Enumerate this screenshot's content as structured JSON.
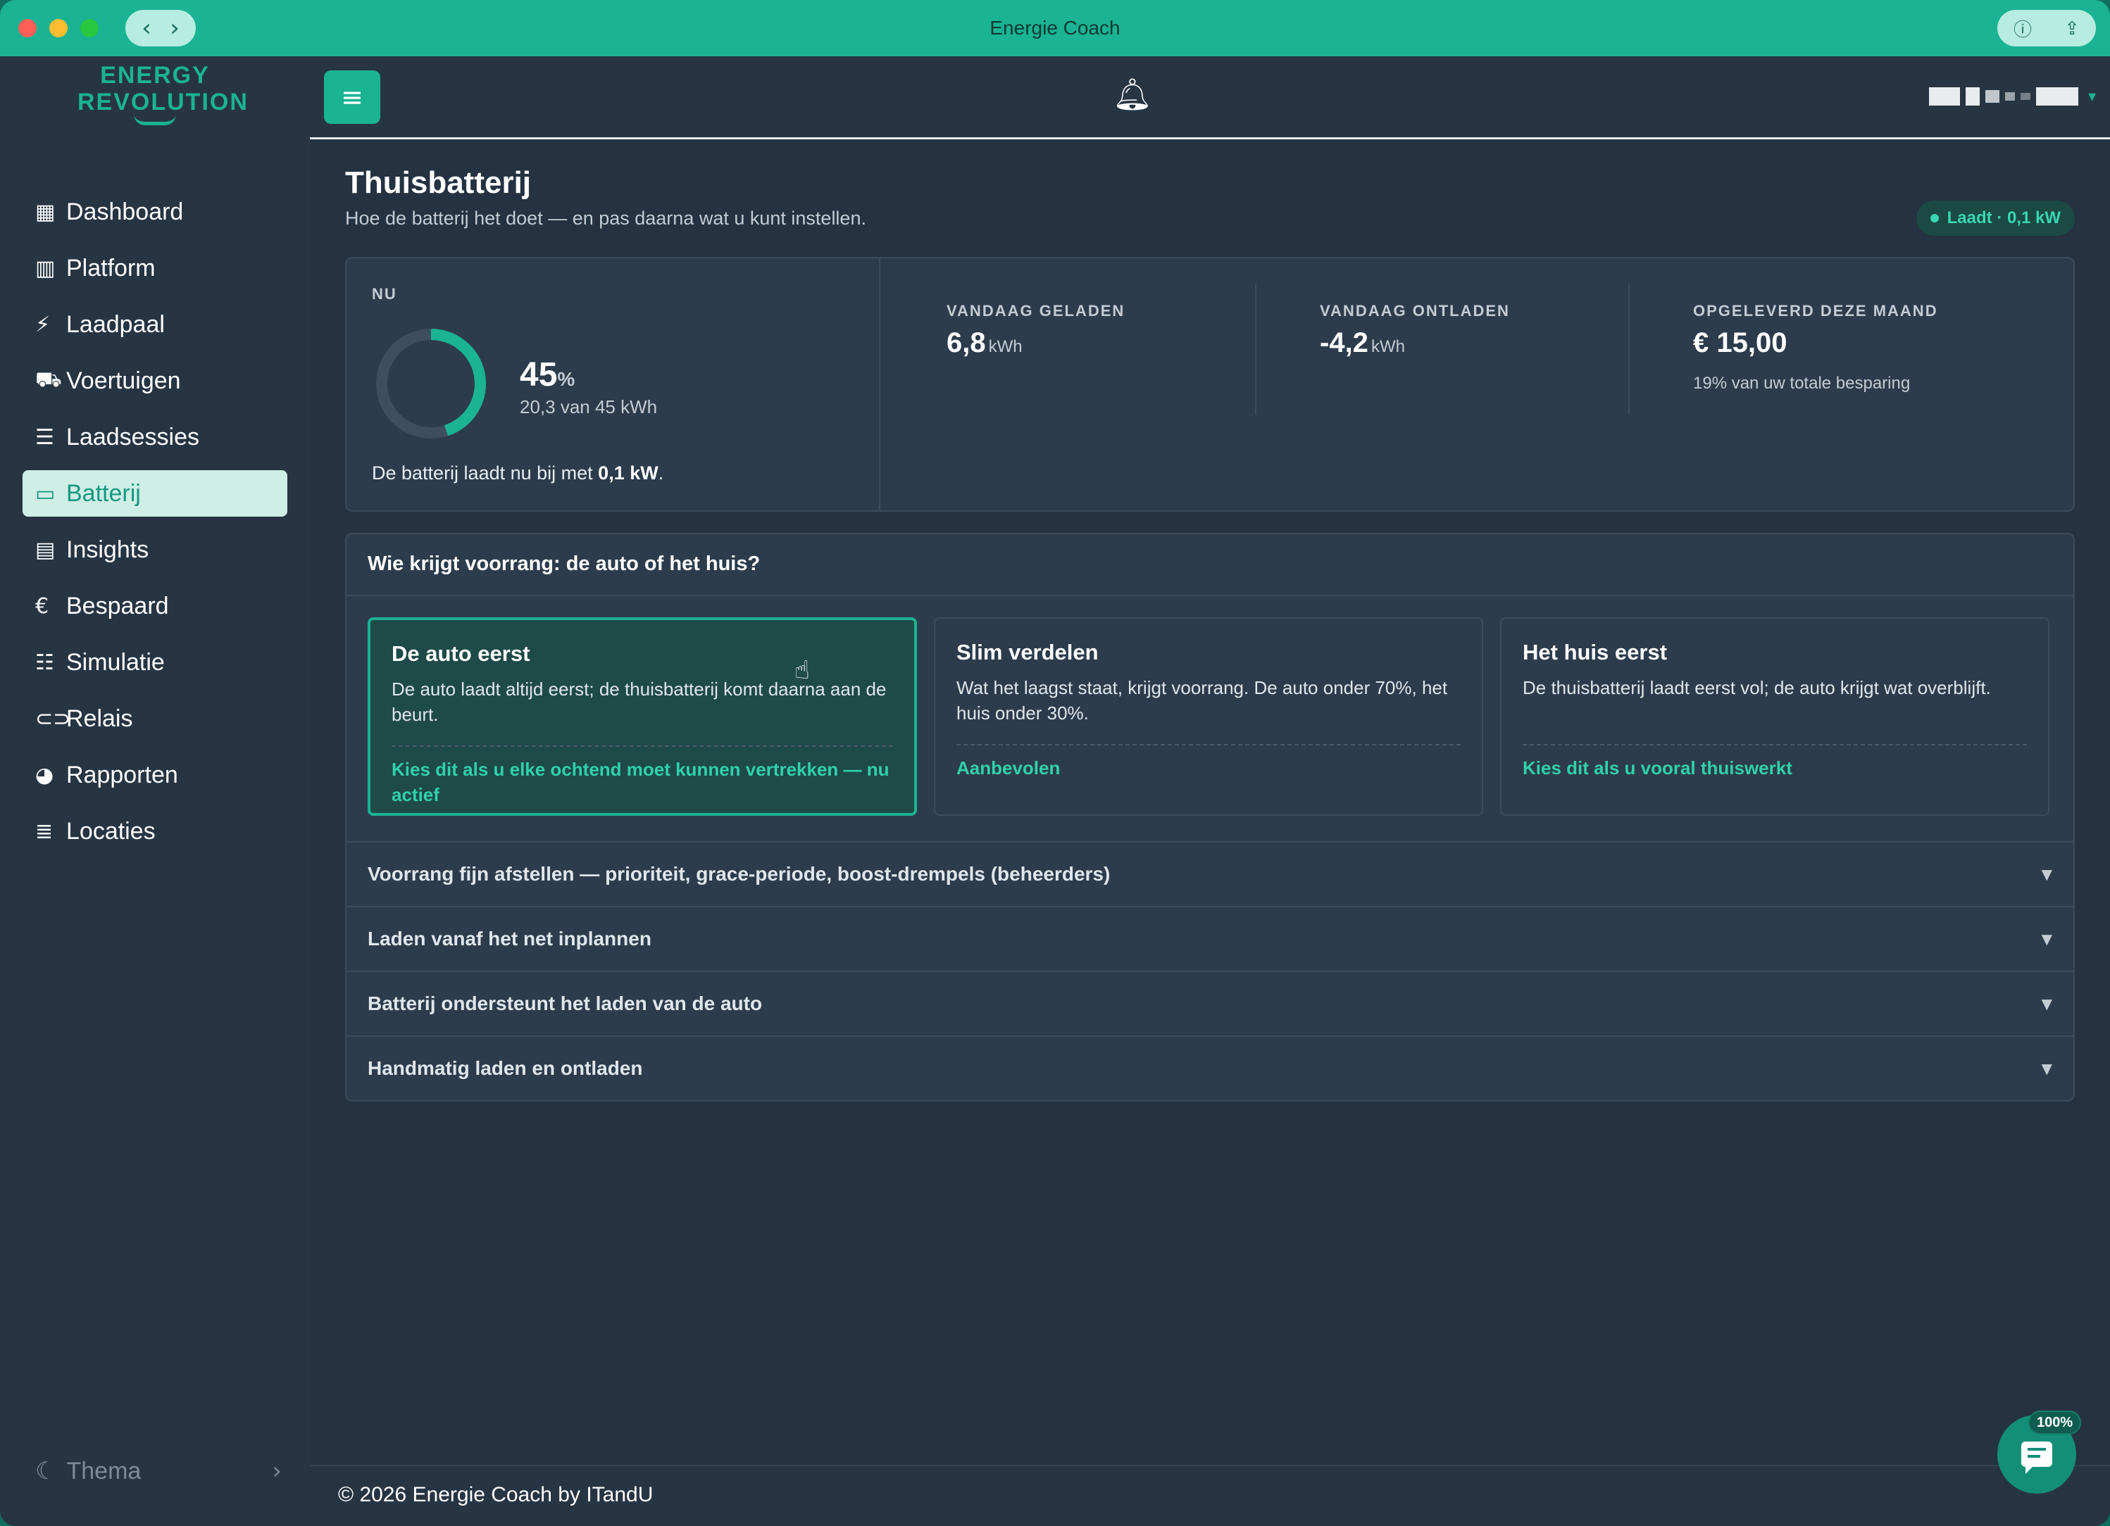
{
  "window": {
    "title": "Energie Coach"
  },
  "brand": {
    "line1": "ENERGY",
    "line2": "REVOLUTION"
  },
  "sidebar": {
    "items": [
      {
        "label": "Dashboard",
        "icon": "grid-icon"
      },
      {
        "label": "Platform",
        "icon": "bar-chart-icon"
      },
      {
        "label": "Laadpaal",
        "icon": "charging-station-icon"
      },
      {
        "label": "Voertuigen",
        "icon": "car-icon"
      },
      {
        "label": "Laadsessies",
        "icon": "list-icon"
      },
      {
        "label": "Batterij",
        "icon": "battery-icon"
      },
      {
        "label": "Insights",
        "icon": "calendar-icon"
      },
      {
        "label": "Bespaard",
        "icon": "euro-icon"
      },
      {
        "label": "Simulatie",
        "icon": "sliders-icon"
      },
      {
        "label": "Relais",
        "icon": "toggle-icon"
      },
      {
        "label": "Rapporten",
        "icon": "pie-chart-icon"
      },
      {
        "label": "Locaties",
        "icon": "server-icon"
      }
    ],
    "active": "Batterij",
    "theme_label": "Thema"
  },
  "page": {
    "title": "Thuisbatterij",
    "subtitle": "Hoe de batterij het doet — en pas daarna wat u kunt instellen.",
    "status_pill": "Laadt · 0,1 kW"
  },
  "stats": {
    "now_label": "NU",
    "soc_value": "45",
    "soc_unit": "%",
    "soc_fraction": 0.45,
    "soc_detail": "20,3 van 45 kWh",
    "now_text_prefix": "De batterij laadt nu bij met ",
    "now_text_value": "0,1 kW",
    "now_text_suffix": ".",
    "charged_label": "VANDAAG GELADEN",
    "charged_value": "6,8",
    "charged_unit": "kWh",
    "discharged_label": "VANDAAG ONTLADEN",
    "discharged_value": "-4,2",
    "discharged_unit": "kWh",
    "delivered_label": "OPGELEVERD DEZE MAAND",
    "delivered_value": "€ 15,00",
    "delivered_sub": "19% van uw totale besparing"
  },
  "priority": {
    "heading": "Wie krijgt voorrang: de auto of het huis?",
    "options": [
      {
        "title": "De auto eerst",
        "desc": "De auto laadt altijd eerst; de thuisbatterij komt daarna aan de beurt.",
        "note": "Kies dit als u elke ochtend moet kunnen vertrekken — nu actief",
        "active": true
      },
      {
        "title": "Slim verdelen",
        "desc": "Wat het laagst staat, krijgt voorrang. De auto onder 70%, het huis onder 30%.",
        "note": "Aanbevolen",
        "active": false
      },
      {
        "title": "Het huis eerst",
        "desc": "De thuisbatterij laadt eerst vol; de auto krijgt wat overblijft.",
        "note": "Kies dit als u vooral thuiswerkt",
        "active": false
      }
    ],
    "accordions": [
      "Voorrang fijn afstellen — prioriteit, grace-periode, boost-drempels (beheerders)",
      "Laden vanaf het net inplannen",
      "Batterij ondersteunt het laden van de auto",
      "Handmatig laden en ontladen"
    ]
  },
  "footer": {
    "text": "© 2026 Energie Coach by ITandU"
  },
  "chat": {
    "badge": "100%"
  },
  "colors": {
    "accent": "#1ab394",
    "background": "#243241",
    "card": "#2c3c4c"
  }
}
